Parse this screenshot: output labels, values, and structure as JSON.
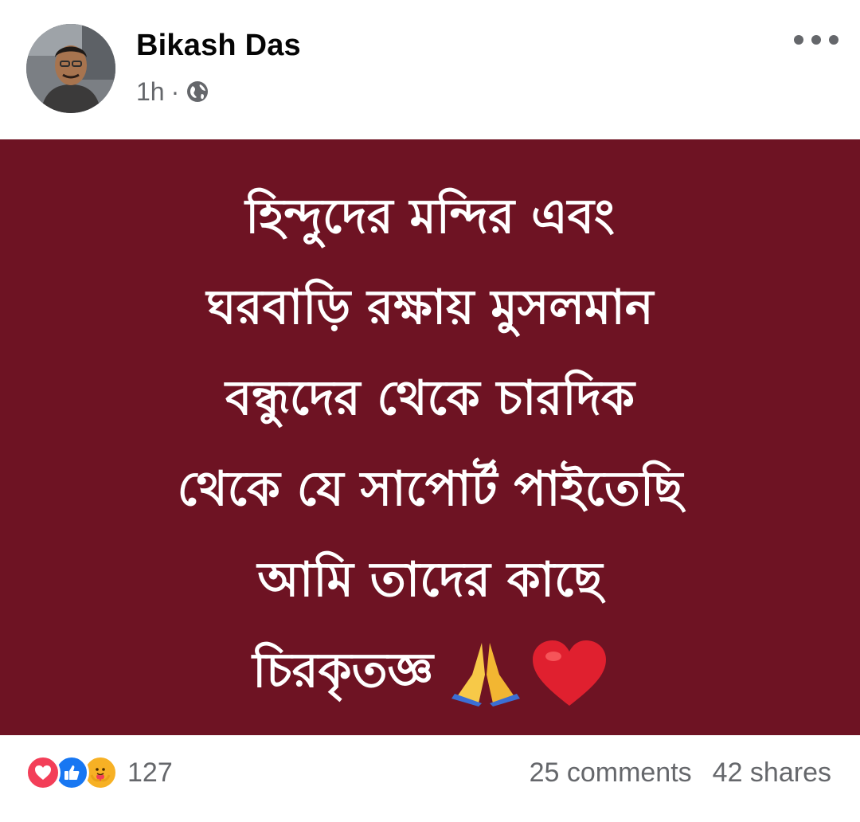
{
  "post": {
    "author": "Bikash Das",
    "time": "1h",
    "separator": "·",
    "privacy_icon": "globe-icon",
    "more_icon": "more-options-icon",
    "background_color": "#6e1323",
    "text": "হিন্দুদের মন্দির এবং\nঘরবাড়ি রক্ষায় মুসলমান\nবন্ধুদের থেকে চারদিক\nথেকে যে সাপোর্ট পাইতেছি\nআমি তাদের কাছে\nচিরকৃতজ্ঞ",
    "emojis": [
      "folded-hands-icon",
      "red-heart-icon"
    ]
  },
  "footer": {
    "reactions": [
      "love-reaction-icon",
      "like-reaction-icon",
      "care-reaction-icon"
    ],
    "reaction_count": "127",
    "comments": "25 comments",
    "shares": "42 shares"
  },
  "colors": {
    "love": "#f33e58",
    "like": "#1877f2",
    "care": "#f7b125",
    "meta_text": "#65676b"
  }
}
